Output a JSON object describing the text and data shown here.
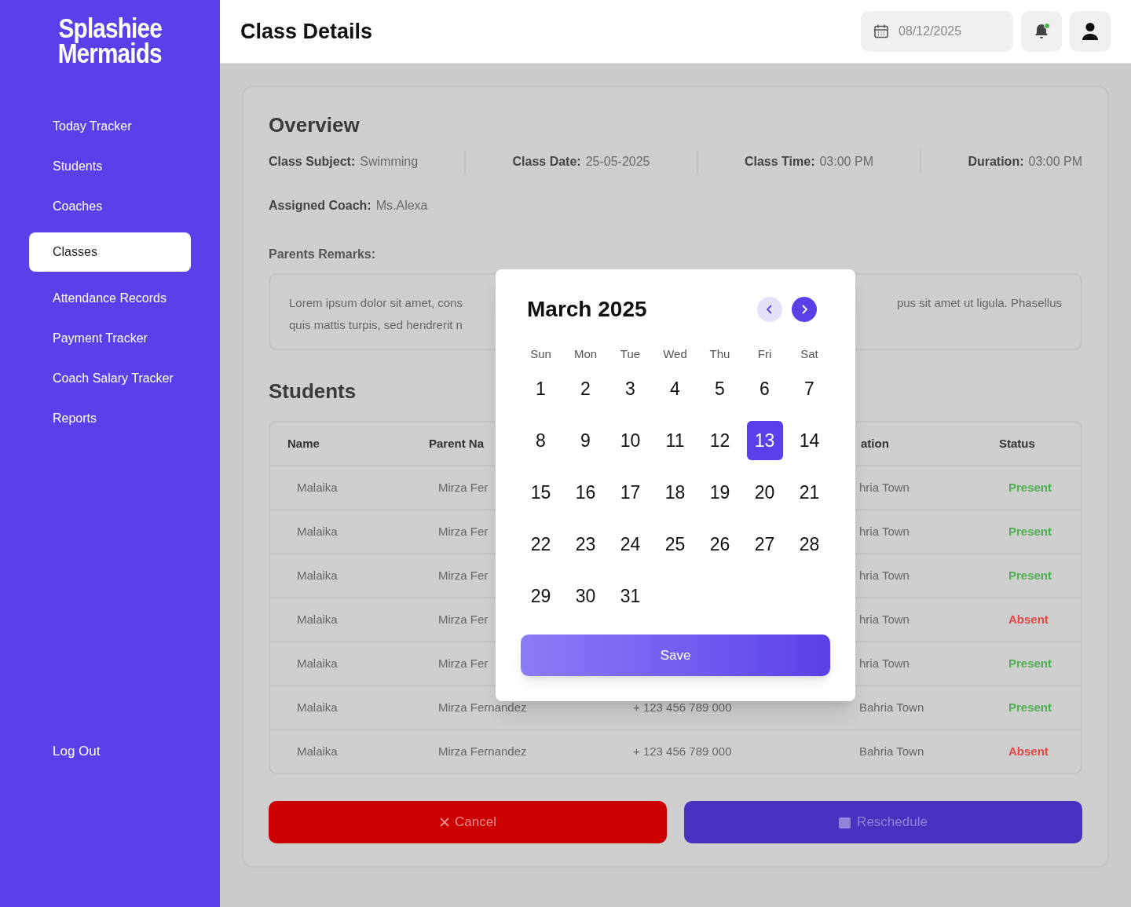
{
  "brand": {
    "line1": "Splashiee",
    "line2": "Mermaids"
  },
  "sidebar": {
    "items": [
      {
        "label": "Today Tracker",
        "selected": false
      },
      {
        "label": "Students",
        "selected": false
      },
      {
        "label": "Coaches",
        "selected": false
      },
      {
        "label": "Classes",
        "selected": true
      },
      {
        "label": "Attendance Records",
        "selected": false
      },
      {
        "label": "Payment Tracker",
        "selected": false
      },
      {
        "label": "Coach Salary Tracker",
        "selected": false
      },
      {
        "label": "Reports",
        "selected": false
      }
    ],
    "logout": "Log Out"
  },
  "header": {
    "title": "Class Details",
    "date": "08/12/2025",
    "notification_dot": true
  },
  "overview": {
    "title": "Overview",
    "fields": [
      {
        "label": "Class Subject:",
        "value": "Swimming"
      },
      {
        "label": "Class Date:",
        "value": "25-05-2025"
      },
      {
        "label": "Class Time:",
        "value": "03:00 PM"
      },
      {
        "label": "Duration:",
        "value": "03:00 PM"
      }
    ],
    "coach": {
      "label": "Assigned Coach:",
      "value": "Ms.Alexa"
    },
    "remarks_label": "Parents Remarks:",
    "remarks_left": [
      "Lorem ipsum dolor sit amet, cons",
      "quis mattis turpis, sed hendrerit n"
    ],
    "remarks_right": [
      "pus sit amet ut ligula. Phasellus"
    ]
  },
  "students": {
    "title": "Students",
    "columns": [
      "Name",
      "Parent Na",
      "",
      "ation",
      "Status"
    ],
    "rows": [
      {
        "cells": [
          "Malaika",
          "Mirza Fer",
          "",
          "hria Town",
          "Present"
        ],
        "color": "#4caf50"
      },
      {
        "cells": [
          "Malaika",
          "Mirza Fer",
          "",
          "hria Town",
          "Present"
        ],
        "color": "#4caf50"
      },
      {
        "cells": [
          "Malaika",
          "Mirza Fer",
          "",
          "hria Town",
          "Present"
        ],
        "color": "#4caf50"
      },
      {
        "cells": [
          "Malaika",
          "Mirza Fer",
          "",
          "hria Town",
          "Absent"
        ],
        "color": "#e04848"
      },
      {
        "cells": [
          "Malaika",
          "Mirza Fer",
          "",
          "hria Town",
          "Present"
        ],
        "color": "#4caf50"
      },
      {
        "cells": [
          "Malaika",
          "Mirza Fernandez",
          "+ 123 456 789 000",
          "Bahria Town",
          "Present"
        ],
        "color": "#4caf50"
      },
      {
        "cells": [
          "Malaika",
          "Mirza Fernandez",
          "+ 123 456 789 000",
          "Bahria Town",
          "Absent"
        ],
        "color": "#e04848"
      }
    ]
  },
  "actions": {
    "cancel": "Cancel",
    "reschedule": "Reschedule"
  },
  "calendar": {
    "title": "March 2025",
    "weekdays": [
      "Sun",
      "Mon",
      "Tue",
      "Wed",
      "Thu",
      "Fri",
      "Sat"
    ],
    "days": [
      {
        "label": "1",
        "selected": false
      },
      {
        "label": "2",
        "selected": false
      },
      {
        "label": "3",
        "selected": false
      },
      {
        "label": "4",
        "selected": false
      },
      {
        "label": "5",
        "selected": false
      },
      {
        "label": "6",
        "selected": false
      },
      {
        "label": "7",
        "selected": false
      },
      {
        "label": "8",
        "selected": false
      },
      {
        "label": "9",
        "selected": false
      },
      {
        "label": "10",
        "selected": false
      },
      {
        "label": "11",
        "selected": false
      },
      {
        "label": "12",
        "selected": false
      },
      {
        "label": "13",
        "selected": true
      },
      {
        "label": "14",
        "selected": false
      },
      {
        "label": "15",
        "selected": false
      },
      {
        "label": "16",
        "selected": false
      },
      {
        "label": "17",
        "selected": false
      },
      {
        "label": "18",
        "selected": false
      },
      {
        "label": "19",
        "selected": false
      },
      {
        "label": "20",
        "selected": false
      },
      {
        "label": "21",
        "selected": false
      },
      {
        "label": "22",
        "selected": false
      },
      {
        "label": "23",
        "selected": false
      },
      {
        "label": "24",
        "selected": false
      },
      {
        "label": "25",
        "selected": false
      },
      {
        "label": "26",
        "selected": false
      },
      {
        "label": "27",
        "selected": false
      },
      {
        "label": "28",
        "selected": false
      },
      {
        "label": "29",
        "selected": false
      },
      {
        "label": "30",
        "selected": false
      },
      {
        "label": "31",
        "selected": false
      }
    ],
    "save": "Save"
  }
}
